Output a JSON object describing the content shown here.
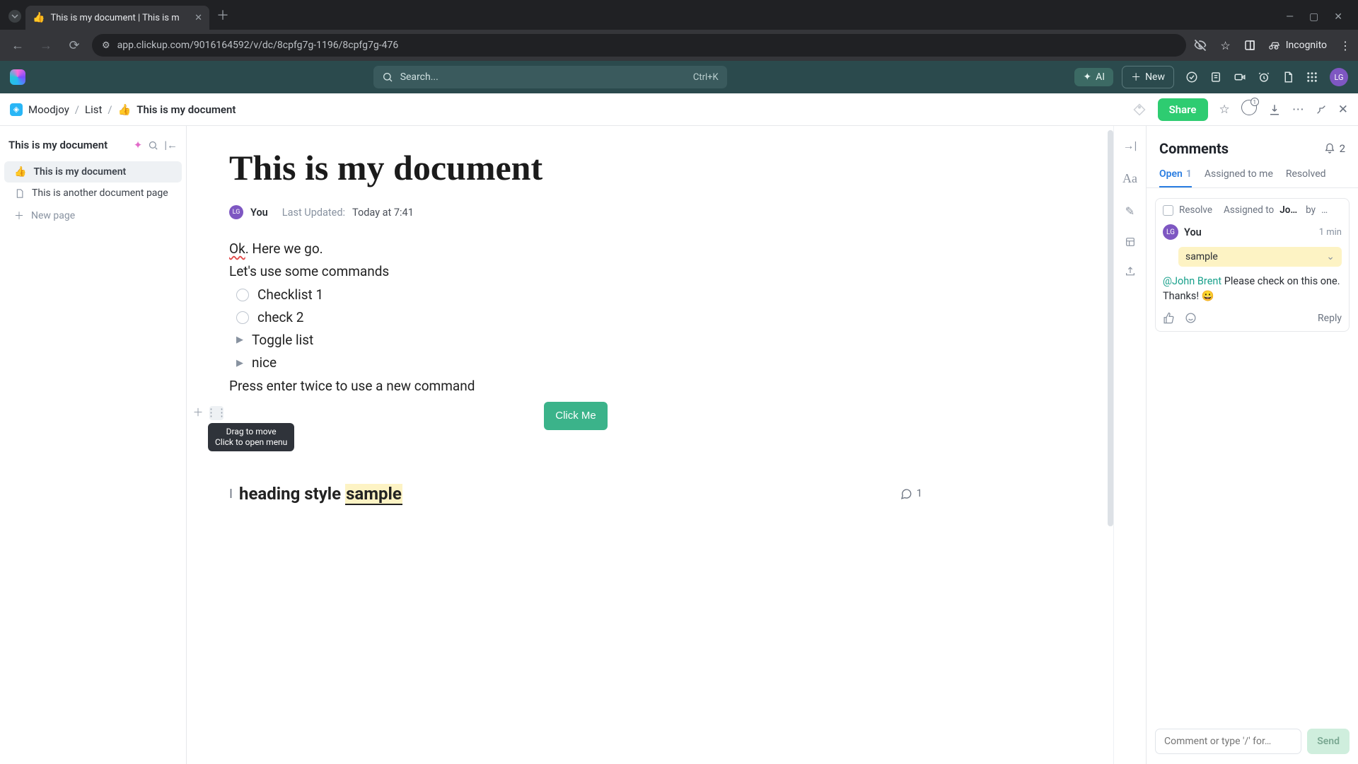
{
  "browser": {
    "tab_title": "This is my document | This is m",
    "tab_favicon": "👍",
    "url": "app.clickup.com/9016164592/v/dc/8cpfg7g-1196/8cpfg7g-476",
    "incognito": "Incognito"
  },
  "topbar": {
    "search_placeholder": "Search...",
    "search_kbd": "Ctrl+K",
    "ai_label": "AI",
    "new_label": "New",
    "avatar": "LG"
  },
  "breadcrumb": {
    "workspace": "Moodjoy",
    "list": "List",
    "doc": "This is my document",
    "doc_emoji": "👍",
    "share": "Share",
    "copies_badge": "1"
  },
  "sidebar": {
    "title": "This is my document",
    "items": [
      {
        "emoji": "👍",
        "label": "This is my document"
      },
      {
        "emoji": "",
        "label": "This is another document page"
      }
    ],
    "new_page": "New page"
  },
  "doc": {
    "title": "This is my document",
    "author": "You",
    "author_initials": "LG",
    "updated_label": "Last Updated:",
    "updated_value": "Today at 7:41",
    "para1_a": "Ok",
    "para1_b": ". Here we go.",
    "para2": "Let's use some commands",
    "check1": "Checklist 1",
    "check2": "check 2",
    "toggle1": "Toggle list",
    "toggle2": "nice",
    "para3": "Press enter twice to use a new command",
    "button_label": "Click Me",
    "tooltip_l1": "Drag to move",
    "tooltip_l2": "Click to open menu",
    "h2_a": "heading style ",
    "h2_b": "sample",
    "h2_comment_count": "1"
  },
  "comments": {
    "title": "Comments",
    "bell_count": "2",
    "tabs": {
      "open": "Open",
      "open_count": "1",
      "assigned": "Assigned to me",
      "resolved": "Resolved"
    },
    "card": {
      "resolve": "Resolve",
      "assigned_to_label": "Assigned to",
      "assigned_to_name": "Jo…",
      "by_label": "by",
      "by_name": "…",
      "author": "You",
      "author_initials": "LG",
      "time": "1 min",
      "quote": "sample",
      "mention": "@John Brent",
      "text": "Please check on this one. Thanks! 😀",
      "reply": "Reply"
    },
    "input_placeholder": "Comment or type '/' for…",
    "send": "Send"
  }
}
